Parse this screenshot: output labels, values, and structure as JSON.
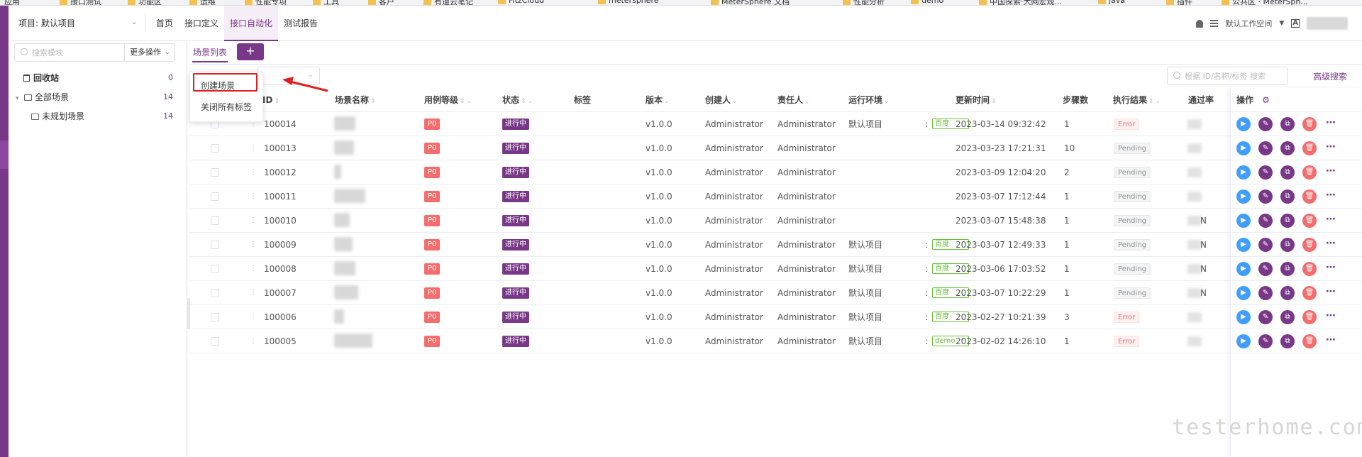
{
  "bookmarks": [
    "应用",
    "接口测试",
    "功能区",
    "运维",
    "性能专项",
    "工具",
    "客户",
    "有道云笔记",
    "FitzCloud",
    "metersphere",
    "MeterSphere 文档",
    "性能分析",
    "demo",
    "中国探索·大网宏观...",
    "java",
    "插件",
    "公共区 · MeterSph..."
  ],
  "header": {
    "project_label": "项目: 默认项目",
    "nav": [
      "首页",
      "接口定义",
      "接口自动化",
      "测试报告"
    ],
    "active_nav": "接口自动化",
    "workspace": "默认工作空间"
  },
  "sidebar": {
    "search_placeholder": "搜索模块",
    "more_ops": "更多操作",
    "recycle": {
      "label": "回收站",
      "count": "0"
    },
    "all_scenes": {
      "label": "全部场景",
      "count": "14"
    },
    "unplanned": {
      "label": "未规划场景",
      "count": "14"
    }
  },
  "main": {
    "tab_label": "场景列表",
    "add_label": "+",
    "id_search_placeholder": "根据 ID/名称/标签 搜索",
    "advanced_search": "高级搜索",
    "dropdown": {
      "items": [
        "创建场景",
        "关闭所有标签"
      ]
    }
  },
  "table": {
    "columns": {
      "id": "ID",
      "name": "场景名称",
      "level": "用例等级",
      "status": "状态",
      "tags": "标签",
      "version": "版本",
      "creator": "创建人",
      "owner": "责任人",
      "env": "运行环境",
      "update_time": "更新时间",
      "steps": "步骤数",
      "result": "执行结果",
      "pass_rate": "通过率",
      "ops": "操作"
    },
    "rows": [
      {
        "id": "100014",
        "level": "P0",
        "status": "进行中",
        "version": "v1.0.0",
        "creator": "Administrator",
        "owner": "Administrator",
        "env_project": "默认项目",
        "env_name": "百度",
        "update_time": "2023-03-14 09:32:42",
        "steps": "1",
        "result": "Error",
        "pass": ""
      },
      {
        "id": "100013",
        "level": "P0",
        "status": "进行中",
        "version": "v1.0.0",
        "creator": "Administrator",
        "owner": "Administrator",
        "env_project": "",
        "env_name": "",
        "update_time": "2023-03-23 17:21:31",
        "steps": "10",
        "result": "Pending",
        "pass": ""
      },
      {
        "id": "100012",
        "level": "P0",
        "status": "进行中",
        "version": "v1.0.0",
        "creator": "Administrator",
        "owner": "Administrator",
        "env_project": "",
        "env_name": "",
        "update_time": "2023-03-09 12:04:20",
        "steps": "2",
        "result": "Pending",
        "pass": ""
      },
      {
        "id": "100011",
        "level": "P0",
        "status": "进行中",
        "version": "v1.0.0",
        "creator": "Administrator",
        "owner": "Administrator",
        "env_project": "",
        "env_name": "",
        "update_time": "2023-03-07 17:12:44",
        "steps": "1",
        "result": "Pending",
        "pass": ""
      },
      {
        "id": "100010",
        "level": "P0",
        "status": "进行中",
        "version": "v1.0.0",
        "creator": "Administrator",
        "owner": "Administrator",
        "env_project": "",
        "env_name": "",
        "update_time": "2023-03-07 15:48:38",
        "steps": "1",
        "result": "Pending",
        "pass": "N"
      },
      {
        "id": "100009",
        "level": "P0",
        "status": "进行中",
        "version": "v1.0.0",
        "creator": "Administrator",
        "owner": "Administrator",
        "env_project": "默认项目",
        "env_name": "百度",
        "update_time": "2023-03-07 12:49:33",
        "steps": "1",
        "result": "Pending",
        "pass": "N"
      },
      {
        "id": "100008",
        "level": "P0",
        "status": "进行中",
        "version": "v1.0.0",
        "creator": "Administrator",
        "owner": "Administrator",
        "env_project": "默认项目",
        "env_name": "百度",
        "update_time": "2023-03-06 17:03:52",
        "steps": "1",
        "result": "Pending",
        "pass": "N"
      },
      {
        "id": "100007",
        "level": "P0",
        "status": "进行中",
        "version": "v1.0.0",
        "creator": "Administrator",
        "owner": "Administrator",
        "env_project": "默认项目",
        "env_name": "百度",
        "update_time": "2023-03-07 10:22:29",
        "steps": "1",
        "result": "Pending",
        "pass": "N"
      },
      {
        "id": "100006",
        "level": "P0",
        "status": "进行中",
        "version": "v1.0.0",
        "creator": "Administrator",
        "owner": "Administrator",
        "env_project": "默认项目",
        "env_name": "百度",
        "update_time": "2023-02-27 10:21:39",
        "steps": "3",
        "result": "Error",
        "pass": ""
      },
      {
        "id": "100005",
        "level": "P0",
        "status": "进行中",
        "version": "v1.0.0",
        "creator": "Administrator",
        "owner": "Administrator",
        "env_project": "默认项目",
        "env_name": "demo",
        "update_time": "2023-02-02 14:26:10",
        "steps": "1",
        "result": "Error",
        "pass": ""
      }
    ]
  },
  "watermark": "testerhome.com",
  "colors": {
    "brand": "#783887",
    "danger": "#f56c6c",
    "primary": "#409eff",
    "success": "#67c23a",
    "annotation": "#e02020"
  }
}
